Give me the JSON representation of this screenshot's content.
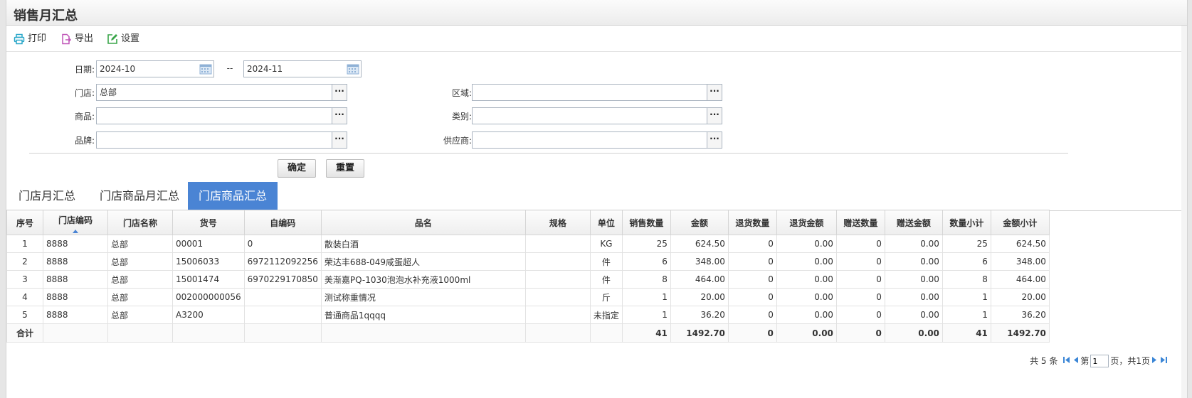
{
  "page": {
    "title": "销售月汇总"
  },
  "toolbar": {
    "print": "打印",
    "export": "导出",
    "settings": "设置"
  },
  "form": {
    "date_label": "日期:",
    "date_from": "2024-10",
    "date_sep": "--",
    "date_to": "2024-11",
    "store_label": "门店:",
    "store_value": "总部",
    "region_label": "区域:",
    "region_value": "",
    "goods_label": "商品:",
    "goods_value": "",
    "category_label": "类别:",
    "category_value": "",
    "brand_label": "品牌:",
    "brand_value": "",
    "supplier_label": "供应商:",
    "supplier_value": "",
    "ok_button": "确定",
    "reset_button": "重置",
    "dots": "···"
  },
  "tabs": [
    "门店月汇总",
    "门店商品月汇总",
    "门店商品汇总"
  ],
  "table": {
    "headers": [
      "序号",
      "门店编码",
      "门店名称",
      "货号",
      "自编码",
      "品名",
      "规格",
      "单位",
      "销售数量",
      "金额",
      "退货数量",
      "退货金额",
      "赠送数量",
      "赠送金额",
      "数量小计",
      "金额小计"
    ],
    "rows": [
      [
        "1",
        "8888",
        "总部",
        "00001",
        "0",
        "散装白酒",
        "",
        "KG",
        "25",
        "624.50",
        "0",
        "0.00",
        "0",
        "0.00",
        "25",
        "624.50"
      ],
      [
        "2",
        "8888",
        "总部",
        "15006033",
        "6972112092256",
        "荣达丰688-049咸蛋超人",
        "",
        "件",
        "6",
        "348.00",
        "0",
        "0.00",
        "0",
        "0.00",
        "6",
        "348.00"
      ],
      [
        "3",
        "8888",
        "总部",
        "15001474",
        "6970229170850",
        "美渐嘉PQ-1030泡泡水补充液1000ml",
        "",
        "件",
        "8",
        "464.00",
        "0",
        "0.00",
        "0",
        "0.00",
        "8",
        "464.00"
      ],
      [
        "4",
        "8888",
        "总部",
        "002000000056",
        "",
        "测试称重情况",
        "",
        "斤",
        "1",
        "20.00",
        "0",
        "0.00",
        "0",
        "0.00",
        "1",
        "20.00"
      ],
      [
        "5",
        "8888",
        "总部",
        "A3200",
        "",
        "普通商品1qqqq",
        "",
        "未指定",
        "1",
        "36.20",
        "0",
        "0.00",
        "0",
        "0.00",
        "1",
        "36.20"
      ]
    ],
    "total": [
      "合计",
      "",
      "",
      "",
      "",
      "",
      "",
      "",
      "41",
      "1492.70",
      "0",
      "0.00",
      "0",
      "0.00",
      "41",
      "1492.70"
    ]
  },
  "pager": {
    "count_text": "共 5 条",
    "page_prefix": "第",
    "page_value": "1",
    "page_suffix": "页，共1页"
  },
  "colors": {
    "accent": "#4a84d4",
    "print_icon": "#2aa7c9",
    "export_icon": "#c056b8",
    "settings_icon": "#3aa64a"
  }
}
